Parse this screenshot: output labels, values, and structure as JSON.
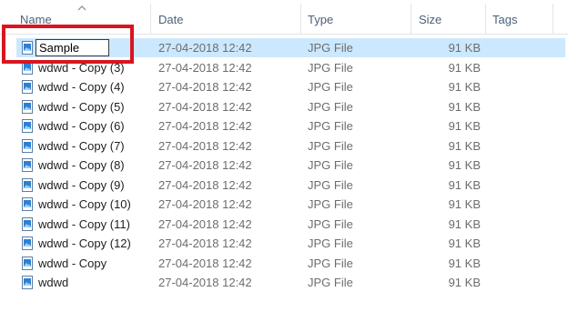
{
  "columns": {
    "name": "Name",
    "date": "Date",
    "type": "Type",
    "size": "Size",
    "tags": "Tags"
  },
  "sort": {
    "column": "name",
    "direction": "ascending",
    "icon": "sort-up-chevron-icon"
  },
  "rename": {
    "value": "Sample"
  },
  "files": [
    {
      "name": "Sample",
      "date": "27-04-2018 12:42",
      "type": "JPG File",
      "size": "91 KB",
      "selected": true,
      "renaming": true
    },
    {
      "name": "wdwd - Copy (3)",
      "date": "27-04-2018 12:42",
      "type": "JPG File",
      "size": "91 KB"
    },
    {
      "name": "wdwd - Copy (4)",
      "date": "27-04-2018 12:42",
      "type": "JPG File",
      "size": "91 KB"
    },
    {
      "name": "wdwd - Copy (5)",
      "date": "27-04-2018 12:42",
      "type": "JPG File",
      "size": "91 KB"
    },
    {
      "name": "wdwd - Copy (6)",
      "date": "27-04-2018 12:42",
      "type": "JPG File",
      "size": "91 KB"
    },
    {
      "name": "wdwd - Copy (7)",
      "date": "27-04-2018 12:42",
      "type": "JPG File",
      "size": "91 KB"
    },
    {
      "name": "wdwd - Copy (8)",
      "date": "27-04-2018 12:42",
      "type": "JPG File",
      "size": "91 KB"
    },
    {
      "name": "wdwd - Copy (9)",
      "date": "27-04-2018 12:42",
      "type": "JPG File",
      "size": "91 KB"
    },
    {
      "name": "wdwd - Copy (10)",
      "date": "27-04-2018 12:42",
      "type": "JPG File",
      "size": "91 KB"
    },
    {
      "name": "wdwd - Copy (11)",
      "date": "27-04-2018 12:42",
      "type": "JPG File",
      "size": "91 KB"
    },
    {
      "name": "wdwd - Copy (12)",
      "date": "27-04-2018 12:42",
      "type": "JPG File",
      "size": "91 KB"
    },
    {
      "name": "wdwd - Copy",
      "date": "27-04-2018 12:42",
      "type": "JPG File",
      "size": "91 KB"
    },
    {
      "name": "wdwd",
      "date": "27-04-2018 12:42",
      "type": "JPG File",
      "size": "91 KB"
    }
  ],
  "colors": {
    "selection": "#cce8ff",
    "highlight_box": "#d9151f",
    "header_text": "#4c607a",
    "detail_text": "#6d6d6d"
  },
  "file_icon": "jpg-image-file-icon"
}
